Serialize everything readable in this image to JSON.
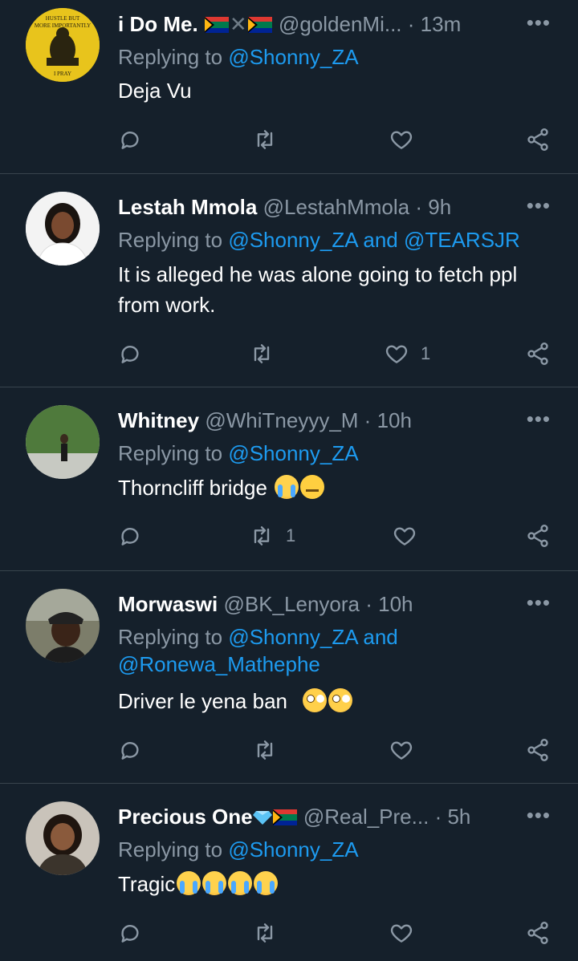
{
  "colors": {
    "background": "#15202b",
    "divider": "#38444d",
    "mention": "#1d9bf0",
    "muted": "#8b98a5"
  },
  "icons": {
    "reply": "comment-icon",
    "retweet": "retweet-icon",
    "like": "heart-icon",
    "share": "share-icon",
    "more": "more-icon"
  },
  "tweets": [
    {
      "name": "i Do Me.",
      "handle": "@goldenMi...",
      "dot": "·",
      "time": "13m",
      "reply_prefix": "Replying to",
      "mentions": "@Shonny_ZA",
      "text": "Deja Vu",
      "avatar_text_top": "HUSTLE BUT MORE IMPORTANTLY",
      "avatar_text_bottom": "I PRAY",
      "likes": "",
      "retweets": ""
    },
    {
      "name": "Lestah Mmola",
      "handle": "@LestahMmola",
      "dot": "·",
      "time": "9h",
      "reply_prefix": "Replying to",
      "mentions": "@Shonny_ZA and @TEARSJR",
      "text": "It is alleged he was alone going to fetch ppl from work.",
      "likes": "1",
      "retweets": ""
    },
    {
      "name": "Whitney",
      "handle": "@WhiTneyyy_M",
      "dot": "·",
      "time": "10h",
      "reply_prefix": "Replying to",
      "mentions": "@Shonny_ZA",
      "text": "Thorncliff bridge",
      "likes": "",
      "retweets": "1"
    },
    {
      "name": "Morwaswi",
      "handle": "@BK_Lenyora",
      "dot": "·",
      "time": "10h",
      "reply_prefix": "Replying to",
      "mentions": "@Shonny_ZA and @Ronewa_Mathephe",
      "text": "Driver le yena ban",
      "likes": "",
      "retweets": ""
    },
    {
      "name": "Precious One",
      "handle": "@Real_Pre...",
      "dot": "·",
      "time": "5h",
      "reply_prefix": "Replying to",
      "mentions": "@Shonny_ZA",
      "text": "Tragic",
      "likes": "",
      "retweets": ""
    }
  ]
}
